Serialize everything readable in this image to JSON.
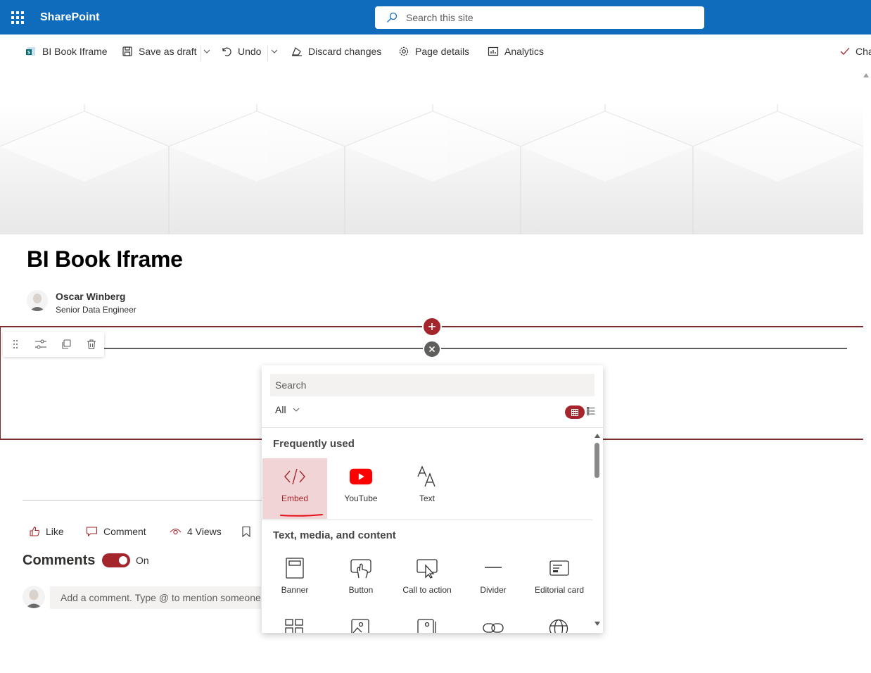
{
  "suite": {
    "brand": "SharePoint",
    "search_placeholder": "Search this site"
  },
  "commandbar": {
    "page_name": "BI Book Iframe",
    "save_draft": "Save as draft",
    "undo": "Undo",
    "discard": "Discard changes",
    "page_details": "Page details",
    "analytics": "Analytics",
    "right_partial": "Cha"
  },
  "page": {
    "title": "BI Book Iframe",
    "author_name": "Oscar Winberg",
    "author_role": "Senior Data Engineer"
  },
  "toolbox": {
    "search_placeholder": "Search",
    "filter": "All",
    "frequently_used_heading": "Frequently used",
    "frequently_used": [
      {
        "label": "Embed",
        "icon": "embed-icon"
      },
      {
        "label": "YouTube",
        "icon": "youtube-icon"
      },
      {
        "label": "Text",
        "icon": "text-icon"
      }
    ],
    "text_media_heading": "Text, media, and content",
    "text_media": [
      {
        "label": "Banner",
        "icon": "banner-icon"
      },
      {
        "label": "Button",
        "icon": "button-icon"
      },
      {
        "label": "Call to action",
        "icon": "call-to-action-icon"
      },
      {
        "label": "Divider",
        "icon": "divider-icon"
      },
      {
        "label": "Editorial card",
        "icon": "editorial-card-icon"
      }
    ]
  },
  "social": {
    "like": "Like",
    "comment": "Comment",
    "views": "4 Views"
  },
  "comments": {
    "heading": "Comments",
    "toggle_state": "On",
    "input_placeholder": "Add a comment. Type @ to mention someone"
  },
  "colors": {
    "suite_bar": "#0f6cbd",
    "accent": "#a4262c",
    "embed_tile_bg": "#f1d4d6"
  }
}
